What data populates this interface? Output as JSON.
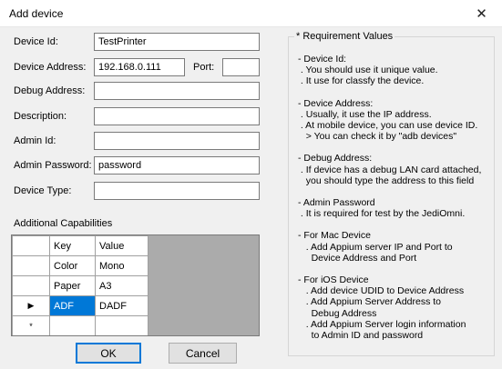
{
  "window": {
    "title": "Add device",
    "close_glyph": "✕"
  },
  "form": {
    "device_id": {
      "label": "Device Id:",
      "value": "TestPrinter"
    },
    "device_address": {
      "label": "Device Address:",
      "value": "192.168.0.111"
    },
    "port": {
      "label": "Port:",
      "value": ""
    },
    "debug_address": {
      "label": "Debug Address:",
      "value": ""
    },
    "description": {
      "label": "Description:",
      "value": ""
    },
    "admin_id": {
      "label": "Admin Id:",
      "value": ""
    },
    "admin_password": {
      "label": "Admin Password:",
      "value": "password"
    },
    "device_type": {
      "label": "Device Type:",
      "value": ""
    }
  },
  "capabilities": {
    "label": "Additional Capabilities",
    "columns": [
      "Key",
      "Value"
    ],
    "rows": [
      {
        "key": "Color",
        "value": "Mono"
      },
      {
        "key": "Paper",
        "value": "A3"
      },
      {
        "key": "ADF",
        "value": "DADF"
      },
      {
        "key": "",
        "value": ""
      }
    ],
    "current_row_marker": "▶",
    "new_row_marker": "*"
  },
  "buttons": {
    "ok": "OK",
    "cancel": "Cancel"
  },
  "requirements": {
    "title": "* Requirement Values",
    "sections": [
      [
        "- Device Id:",
        " . You should use it unique value.",
        " . It use for classfy the device."
      ],
      [
        "- Device Address:",
        " . Usually, it use the IP address.",
        " . At mobile device, you can use device ID.",
        "   > You can check it by \"adb devices\""
      ],
      [
        "- Debug Address:",
        " . If device has a debug LAN card attached,",
        "   you should type the address to this field"
      ],
      [
        "- Admin Password",
        " . It is required for test by the JediOmni."
      ],
      [
        "- For Mac Device",
        "   . Add Appium server IP and Port to",
        "     Device Address and Port"
      ],
      [
        "- For iOS Device",
        "   . Add device UDID to Device Address",
        "   . Add Appium Server Address to",
        "     Debug Address",
        "   . Add Appium Server login information",
        "     to Admin ID and password"
      ]
    ]
  }
}
